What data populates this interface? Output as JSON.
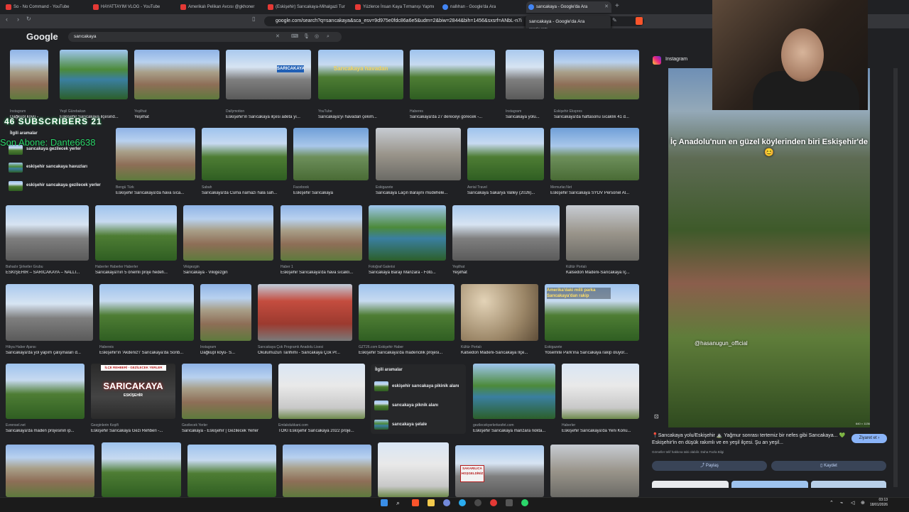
{
  "tabs": [
    {
      "label": "So - No Command - YouTube"
    },
    {
      "label": "HAYATTAYIM VLOG - YouTube"
    },
    {
      "label": "Amerikalı Pelikan Avcısı @gkhoner"
    },
    {
      "label": "(Eskişehir) Sarıcakaya-Mihalgazi Tur"
    },
    {
      "label": "Yüzlerce İnsan Kaya Tırmanışı Yapmı"
    },
    {
      "label": "nallıhan - Google'da Ara"
    },
    {
      "label": "sarıcakaya - Google'da Ara"
    }
  ],
  "tab_tooltip": {
    "title": "sarıcakaya - Google'da Ara",
    "domain": "google.com"
  },
  "url": "google.com/search?q=sarıcakaya&sca_esv=9d975e0fdc86a6e5&udm=2&biw=2844&bih=1456&sxsrf=ANbL-n7i",
  "google": {
    "logo": "Google",
    "query": "sarıcakaya"
  },
  "stream": {
    "subscribers": "46  SUBSCRIBERS  21",
    "sub_name": "Son Abone: Dante6638"
  },
  "related_left": {
    "title": "İlgili aramalar",
    "items": [
      "sarıcakaya gezilecek yerler",
      "eskişehir sarıcakaya havuzları",
      "eskişehir sarıcakaya gezilecek yerler"
    ]
  },
  "related_mid": {
    "title": "İlgili aramalar",
    "items": [
      "eskişehir sarıcakaya pikinik alanı",
      "sarıcakaya piknik alanı",
      "sarıcakaya şelale"
    ]
  },
  "rows": [
    [
      {
        "src": "Instagram",
        "cap": "Dağkupl koyü - ..."
      },
      {
        "src": "Yeşil Gürebakan",
        "cap": "Eskişehir Sarıcakaya ilçesind..."
      },
      {
        "src": "Yeşilhat",
        "cap": "Yeşilhat"
      },
      {
        "src": "Dailymotion",
        "cap": "Eskişehir'in Sarıcakaya ilçesi adeta yı..."
      },
      {
        "src": "YouTube",
        "cap": "Sarıcakaya'yı havadan çekim..."
      },
      {
        "src": "Haberes",
        "cap": "Sarıcakaya'da 27 dereceyi görecek -..."
      },
      {
        "src": "Instagram",
        "cap": "Sarıcakaya yolu..."
      },
      {
        "src": "Eskişehir Ekspres",
        "cap": "Sarıcakaya'da haftasonu sıcaklık 41 d..."
      }
    ],
    [
      {
        "src": "Bengü Türk",
        "cap": "Eskişehir Sarıcakaya'da hava sıca..."
      },
      {
        "src": "Sabah",
        "cap": "Sarıcakaya'da Cuma namazı hala sah..."
      },
      {
        "src": "Facebook",
        "cap": "Eskişehir Sarıcakaya"
      },
      {
        "src": "Eskigazete",
        "cap": "Sarıcakaya Laçin Barajını müdehele..."
      },
      {
        "src": "Aerial Travel",
        "cap": "Sarıcakaya Sakarya Valley (2026)..."
      },
      {
        "src": "Memurlar.Net",
        "cap": "Eskişehir Sarıcakaya SYDV Personel Al..."
      }
    ],
    [
      {
        "src": "Bahadır Şirketler Grubu",
        "cap": "ESKİŞEHİR – SARICAKAYA – NALLI..."
      },
      {
        "src": "Haberler Haberler Haberler",
        "cap": "Sarıcakaya'nın 5 önemli proje hedefi..."
      },
      {
        "src": "Vikigezgin",
        "cap": "Sarıcakaya - Vikigezgin"
      },
      {
        "src": "Haber 1",
        "cap": "Eskişehir Sarıcakaya'da hava sıcaklı..."
      },
      {
        "src": "Fotoğraf Galerisi",
        "cap": "Sarıcakaya Barajı Manzara - Foto..."
      },
      {
        "src": "Yeşilhat",
        "cap": "Yeşilhat"
      },
      {
        "src": "Kültür Portalı",
        "cap": "Kalsedon Madeni-Sarıcakaya İç..."
      }
    ],
    [
      {
        "src": "Hibya Haber Ajansı",
        "cap": "Sarıcakaya'da yol yapım çalışmaları d..."
      },
      {
        "src": "Habereis",
        "cap": "Eskişehir'in 'Akdeniz'i' Sarıcakaya'da Sonb..."
      },
      {
        "src": "Instagram",
        "cap": "Dağkupl köyü- S..."
      },
      {
        "src": "Sarıcakaya Çok Programlı Anadolu Lisesi",
        "cap": "Okulumuzun Tarihimi - Sarıcakaya Çok Pr..."
      },
      {
        "src": "GZT26.com Eskişehir Haber",
        "cap": "Eskişehir Sarıcakaya'da madencilik projesi..."
      },
      {
        "src": "Kültür Portalı",
        "cap": "Kalsedon Madeni-Sarıcakaya İlçe..."
      },
      {
        "src": "Eskigazete",
        "cap": "Yosemite Park'ına Sarıcakaya rakip oluyor..."
      }
    ],
    [
      {
        "src": "Evrensel.net",
        "cap": "Sarıcakaya'da maden projesinin ip..."
      },
      {
        "src": "Gezginlerin Keşifi",
        "cap": "Eskişehir Sarıcakaya Gezi Rehberi -..."
      },
      {
        "src": "Gezilecek Yerler",
        "cap": "Sarıcakaya - Eskişehir | Gezilecek Yerler"
      },
      {
        "src": "Emlakdukkani.com",
        "cap": "TOKİ Eskişehir Sarıcakaya 2022 proje..."
      },
      {
        "src": "gezilecekyerlerkesfet.com",
        "cap": "Eskişehir Sarıcakaya manzara nokta..."
      },
      {
        "src": "Haberler",
        "cap": "Eskişehir Sarıcakaya'da Yeni Konu..."
      }
    ]
  ],
  "thumb_texts": {
    "sign": "SARICAKAYA",
    "aerial": "Sarıcakaya havadan",
    "red_card_top": "İLÇE REHBERİ - GEZİLECEK YERLER",
    "red_card": "SARICAKAYA",
    "red_card_sub": "ESKİŞEHİR",
    "amerika": "Amerika'daki milli parka Sarıcakaya'dan rakip",
    "sakarilica": "SAKARILICA HOŞGELDİNİZ"
  },
  "sidebar": {
    "source": "Instagram",
    "overlay": "İç Anadolu'nun en güzel köylerinden biri Eskişehir'de😊",
    "handle": "@hasanugun_official",
    "dims": "640 × 1136",
    "caption": "📍Sarıcakaya yolu/Eskişehir ⛰️ Yağmur sonrası tertemiz bir nefes gibi Sarıcakaya... 💚 Eskişehir'in en düşük rakımlı ve en yeşil ilçesi. Şu an yeşil...",
    "note": "Görseller telif hakkına tabi olabilir. Daha Fazla Bilgi",
    "visit": "Ziyaret et ›",
    "share": "Paylaş",
    "save": "Kaydet"
  },
  "clock": {
    "time": "03:13",
    "date": "18/01/2026"
  }
}
